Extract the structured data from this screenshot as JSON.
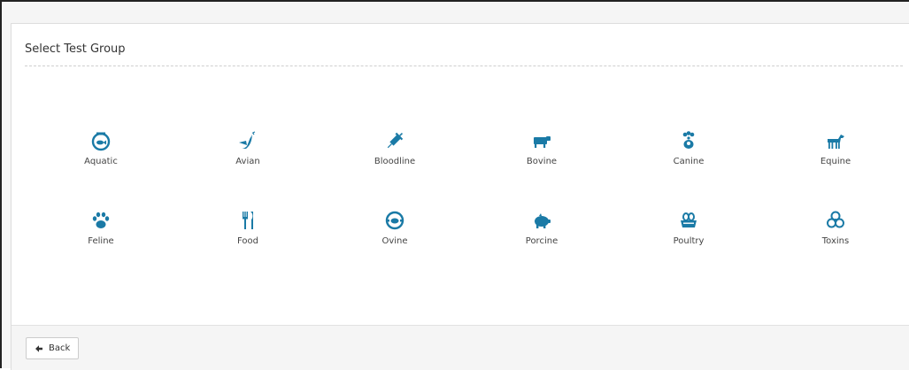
{
  "panel": {
    "title": "Select Test Group"
  },
  "accent_color": "#1a7aa6",
  "groups": [
    {
      "label": "Aquatic",
      "icon": "fishbowl-icon"
    },
    {
      "label": "Avian",
      "icon": "bird-icon"
    },
    {
      "label": "Bloodline",
      "icon": "syringe-icon"
    },
    {
      "label": "Bovine",
      "icon": "cow-icon"
    },
    {
      "label": "Canine",
      "icon": "dog-paw-icon"
    },
    {
      "label": "Equine",
      "icon": "horse-icon"
    },
    {
      "label": "Feline",
      "icon": "cat-paw-icon"
    },
    {
      "label": "Food",
      "icon": "fork-knife-icon"
    },
    {
      "label": "Ovine",
      "icon": "sheep-icon"
    },
    {
      "label": "Porcine",
      "icon": "pig-icon"
    },
    {
      "label": "Poultry",
      "icon": "egg-basket-icon"
    },
    {
      "label": "Toxins",
      "icon": "biohazard-icon"
    }
  ],
  "footer": {
    "back_label": "Back",
    "back_icon": "arrow-left-icon"
  }
}
